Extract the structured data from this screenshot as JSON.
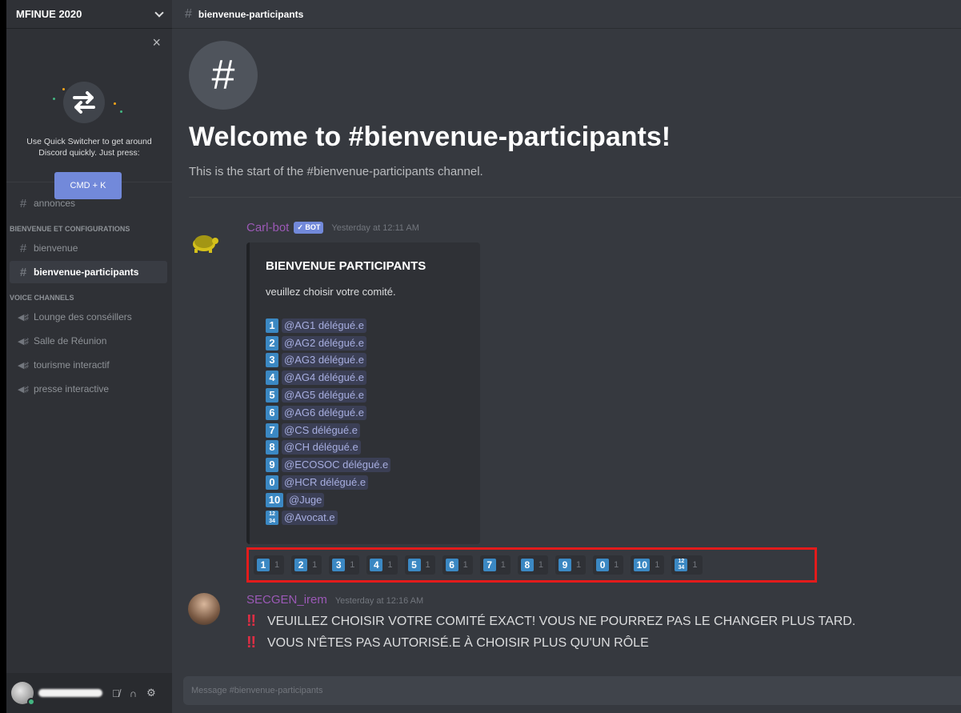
{
  "server": {
    "name": "MFINUE 2020"
  },
  "quick_switcher": {
    "text": "Use Quick Switcher to get around Discord quickly. Just press:",
    "button": "CMD + K"
  },
  "sidebar": {
    "channel_top": "annonces",
    "category1": "BIENVENUE ET CONFIGURATIONS",
    "text_channels": [
      "bienvenue",
      "bienvenue-participants"
    ],
    "category2": "VOICE CHANNELS",
    "voice_channels": [
      "Lounge des conséillers",
      "Salle de Réunion",
      "tourisme interactif",
      "presse interactive"
    ]
  },
  "header": {
    "channel": "bienvenue-participants"
  },
  "welcome": {
    "title": "Welcome to #bienvenue-participants!",
    "subtitle": "This is the start of the #bienvenue-participants channel."
  },
  "message1": {
    "author": "Carl-bot",
    "bot_tag": "✓ BOT",
    "timestamp": "Yesterday at 12:11 AM",
    "embed": {
      "title": "BIENVENUE PARTICIPANTS",
      "description": "veuillez choisir votre comité.",
      "roles": [
        {
          "key": "1",
          "role": "@AG1 délégué.e"
        },
        {
          "key": "2",
          "role": "@AG2 délégué.e"
        },
        {
          "key": "3",
          "role": "@AG3 délégué.e"
        },
        {
          "key": "4",
          "role": "@AG4 délégué.e"
        },
        {
          "key": "5",
          "role": "@AG5 délégué.e"
        },
        {
          "key": "6",
          "role": "@AG6 délégué.e"
        },
        {
          "key": "7",
          "role": "@CS délégué.e"
        },
        {
          "key": "8",
          "role": "@CH délégué.e"
        },
        {
          "key": "9",
          "role": "@ECOSOC délégué.e"
        },
        {
          "key": "0",
          "role": "@HCR délégué.e"
        },
        {
          "key": "10",
          "role": "@Juge"
        },
        {
          "key": "1234",
          "role": "@Avocat.e"
        }
      ]
    },
    "reactions": [
      {
        "key": "1",
        "count": "1"
      },
      {
        "key": "2",
        "count": "1"
      },
      {
        "key": "3",
        "count": "1"
      },
      {
        "key": "4",
        "count": "1"
      },
      {
        "key": "5",
        "count": "1"
      },
      {
        "key": "6",
        "count": "1"
      },
      {
        "key": "7",
        "count": "1"
      },
      {
        "key": "8",
        "count": "1"
      },
      {
        "key": "9",
        "count": "1"
      },
      {
        "key": "0",
        "count": "1"
      },
      {
        "key": "10",
        "count": "1"
      },
      {
        "key": "1234",
        "count": "1"
      }
    ],
    "highlight_color": "#e31b1b"
  },
  "message2": {
    "author": "SECGEN_irem",
    "timestamp": "Yesterday at 12:16 AM",
    "lines": [
      "VEUILLEZ CHOISIR VOTRE COMITÉ EXACT! VOUS NE POURREZ PAS LE CHANGER PLUS TARD.",
      "VOUS N'ÊTES PAS AUTORISÉ.E À CHOISIR PLUS QU'UN RÔLE"
    ]
  },
  "composer": {
    "placeholder": "Message #bienvenue-participants"
  },
  "colors": {
    "accent": "#7289da",
    "keycap": "#3b88c3",
    "author": "#9b59b6"
  }
}
